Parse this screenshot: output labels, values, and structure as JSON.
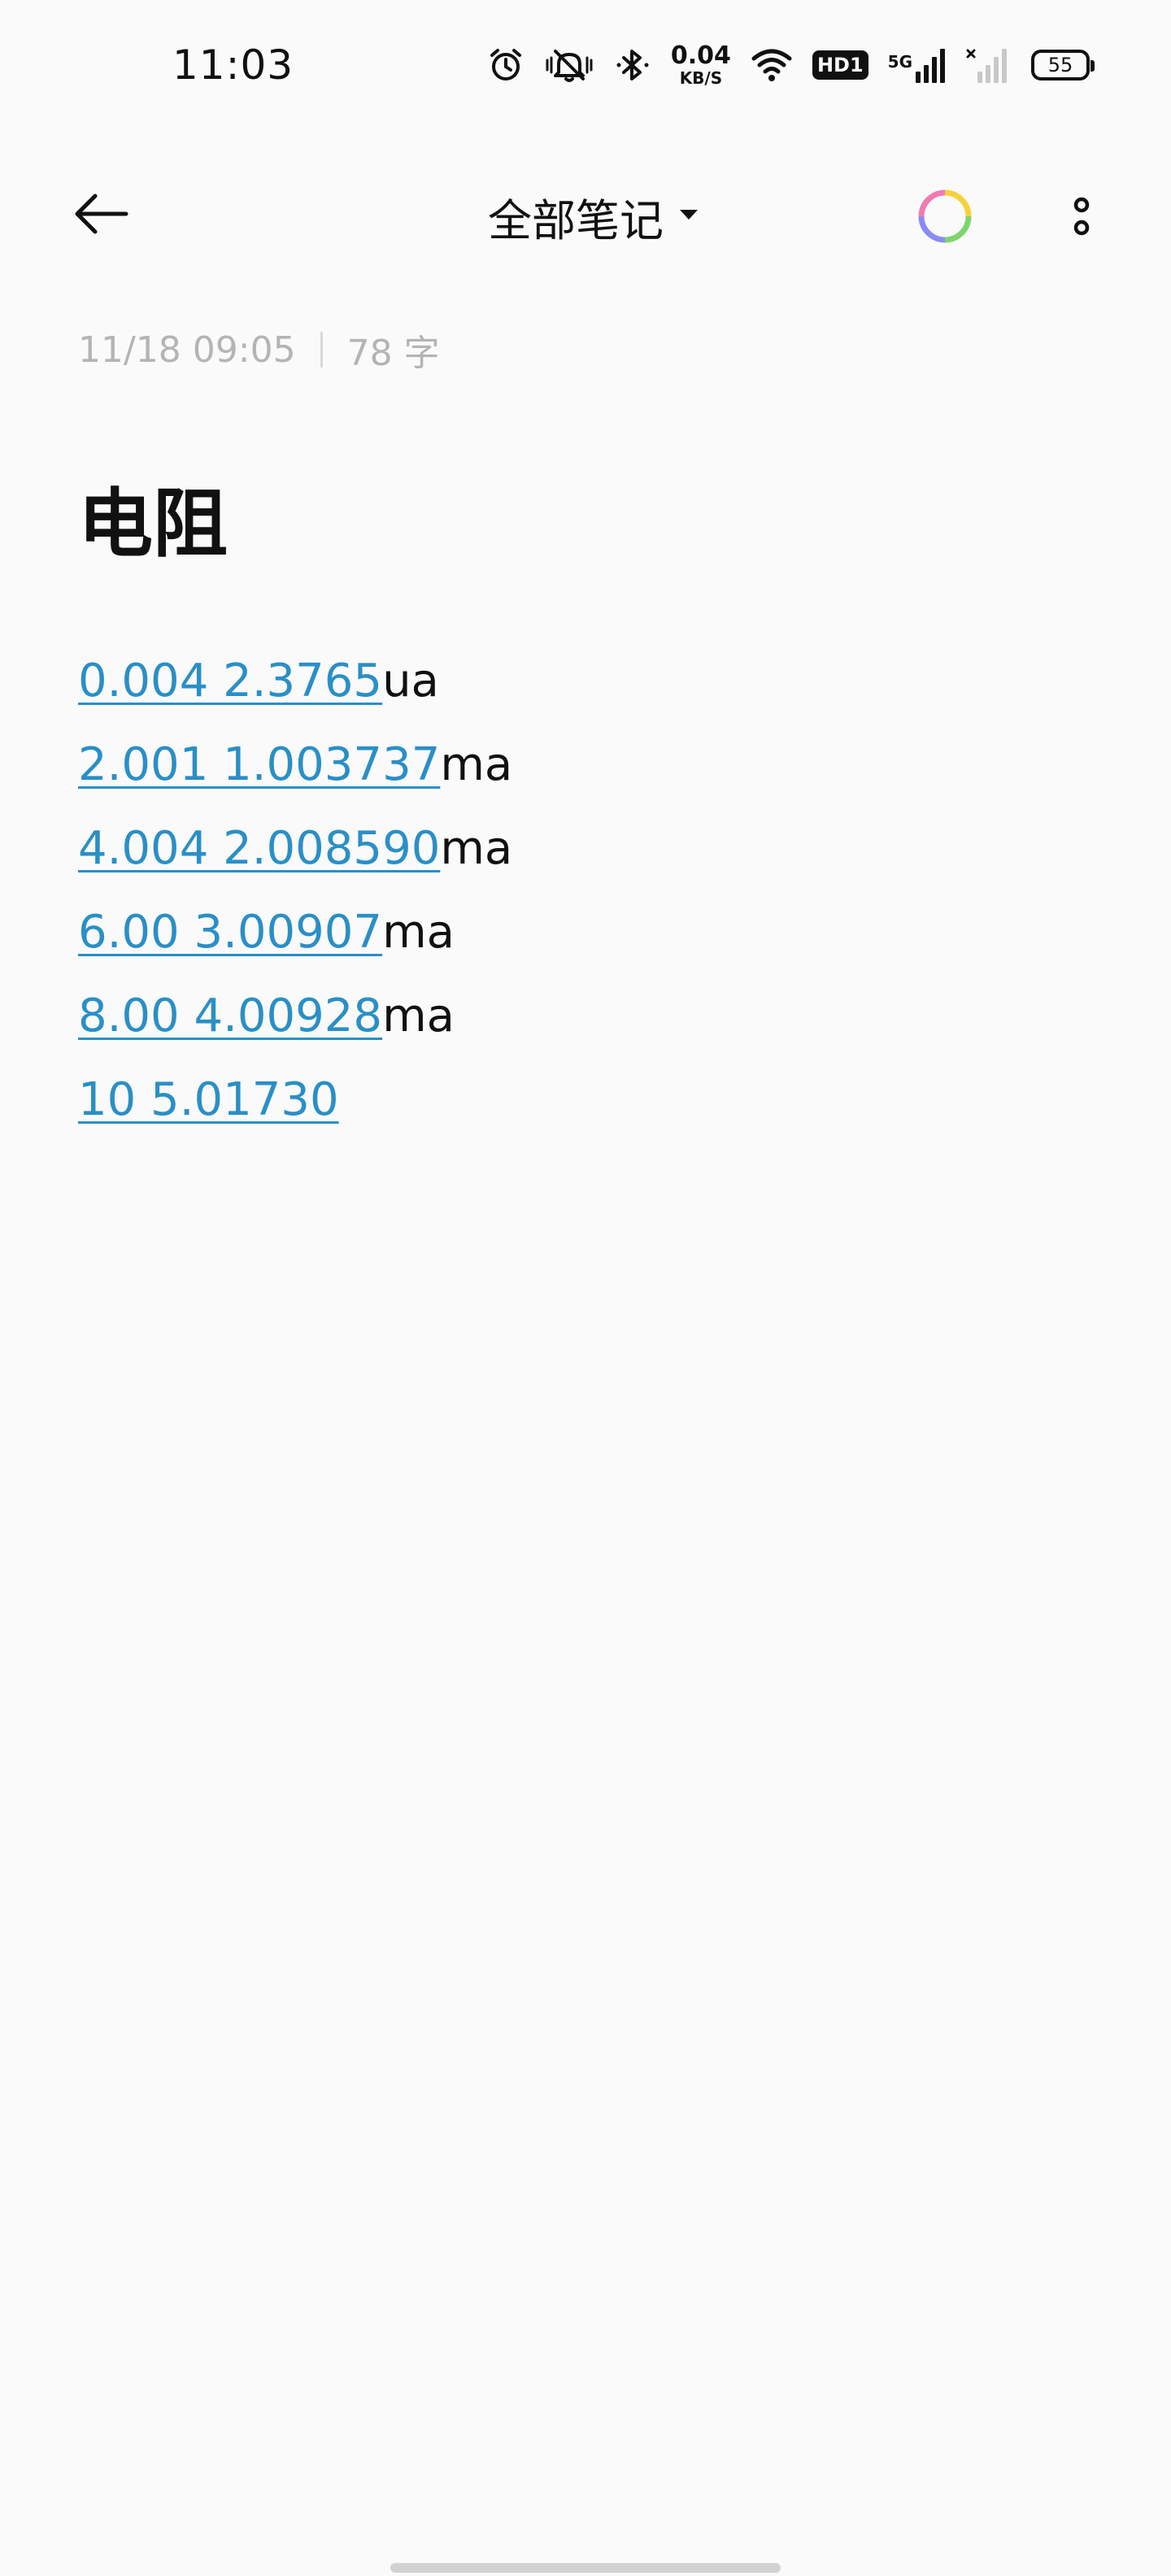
{
  "status_bar": {
    "time": "11:03",
    "net_speed_value": "0.04",
    "net_speed_unit": "KB/S",
    "hd_label": "HD1",
    "network_label": "5G",
    "battery_level": "55",
    "icons": [
      "alarm-icon",
      "mute-icon",
      "bluetooth-icon",
      "wifi-icon",
      "signal-icon",
      "signal-no-service-icon",
      "battery-icon"
    ]
  },
  "app_bar": {
    "back_icon": "arrow-left-icon",
    "folder_title": "全部笔记",
    "dropdown_icon": "triangle-down-icon",
    "color_icon": "color-ring-icon",
    "more_icon": "more-vertical-icon"
  },
  "note": {
    "date": "11/18 09:05",
    "word_count": "78 字",
    "title": "电阻",
    "lines": [
      {
        "link": "0.004 2.3765",
        "unit": "ua"
      },
      {
        "link": "2.001 1.003737",
        "unit": "ma"
      },
      {
        "link": "4.004 2.008590",
        "unit": "ma"
      },
      {
        "link": "6.00 3.00907",
        "unit": "ma"
      },
      {
        "link": "8.00 4.00928",
        "unit": "ma"
      },
      {
        "link": "10 5.01730",
        "unit": ""
      }
    ]
  },
  "colors": {
    "background": "#fafafa",
    "text": "#111111",
    "link": "#2a8fc6",
    "meta": "#b4b4b4"
  }
}
